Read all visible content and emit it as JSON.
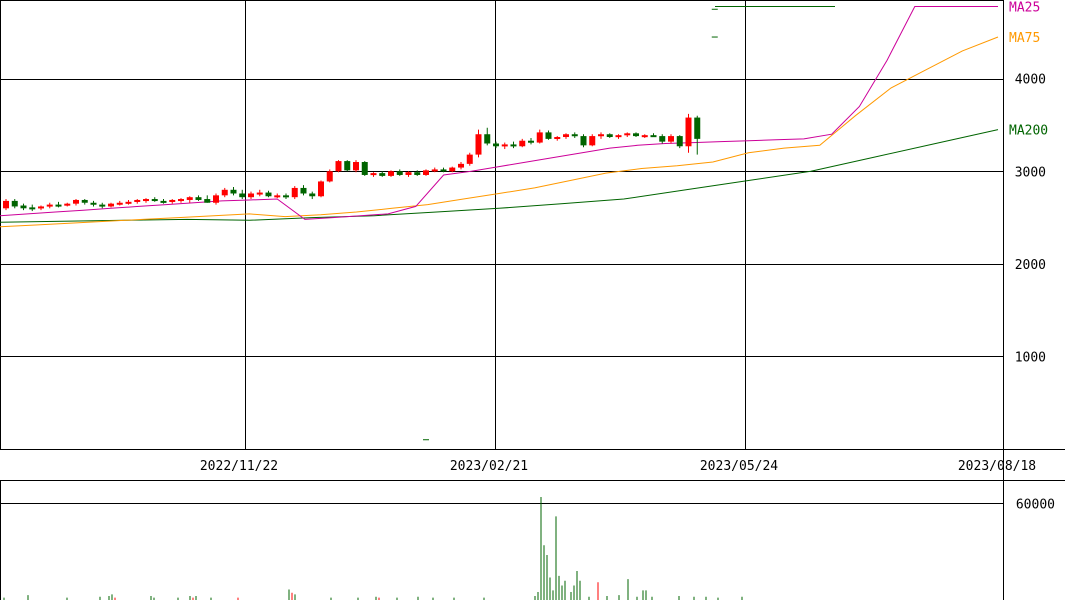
{
  "chart_data": [
    {
      "type": "candlestick",
      "title": "",
      "x_tick_labels": [
        "2022/11/22",
        "2023/02/21",
        "2023/05/24",
        "2023/08/18"
      ],
      "y_ticks": [
        1000,
        2000,
        3000,
        4000
      ],
      "ylim": [
        0,
        4850
      ],
      "grid": true,
      "colors": {
        "up": "#ff0000",
        "down": "#006400",
        "ma25": "#cc0099",
        "ma75": "#ff9900",
        "ma200": "#006400"
      },
      "legend": [
        {
          "name": "MA25",
          "color": "#cc0099",
          "value": 4780
        },
        {
          "name": "MA75",
          "color": "#ff9900",
          "value": 4450
        },
        {
          "name": "MA200",
          "color": "#006400",
          "value": 3450
        }
      ],
      "candles": [
        {
          "o": 2600,
          "h": 2700,
          "l": 2580,
          "c": 2680
        },
        {
          "o": 2680,
          "h": 2700,
          "l": 2600,
          "c": 2620
        },
        {
          "o": 2630,
          "h": 2650,
          "l": 2580,
          "c": 2600
        },
        {
          "o": 2610,
          "h": 2640,
          "l": 2570,
          "c": 2590
        },
        {
          "o": 2600,
          "h": 2630,
          "l": 2580,
          "c": 2620
        },
        {
          "o": 2620,
          "h": 2660,
          "l": 2600,
          "c": 2640
        },
        {
          "o": 2640,
          "h": 2670,
          "l": 2610,
          "c": 2620
        },
        {
          "o": 2630,
          "h": 2660,
          "l": 2620,
          "c": 2650
        },
        {
          "o": 2650,
          "h": 2700,
          "l": 2630,
          "c": 2690
        },
        {
          "o": 2690,
          "h": 2700,
          "l": 2640,
          "c": 2660
        },
        {
          "o": 2660,
          "h": 2680,
          "l": 2620,
          "c": 2640
        },
        {
          "o": 2640,
          "h": 2660,
          "l": 2600,
          "c": 2620
        },
        {
          "o": 2620,
          "h": 2660,
          "l": 2610,
          "c": 2650
        },
        {
          "o": 2650,
          "h": 2680,
          "l": 2630,
          "c": 2660
        },
        {
          "o": 2660,
          "h": 2690,
          "l": 2640,
          "c": 2670
        },
        {
          "o": 2670,
          "h": 2700,
          "l": 2650,
          "c": 2690
        },
        {
          "o": 2690,
          "h": 2710,
          "l": 2660,
          "c": 2700
        },
        {
          "o": 2700,
          "h": 2720,
          "l": 2670,
          "c": 2680
        },
        {
          "o": 2680,
          "h": 2700,
          "l": 2650,
          "c": 2670
        },
        {
          "o": 2670,
          "h": 2700,
          "l": 2650,
          "c": 2690
        },
        {
          "o": 2690,
          "h": 2710,
          "l": 2660,
          "c": 2700
        },
        {
          "o": 2690,
          "h": 2730,
          "l": 2660,
          "c": 2720
        },
        {
          "o": 2720,
          "h": 2740,
          "l": 2680,
          "c": 2690
        },
        {
          "o": 2700,
          "h": 2740,
          "l": 2660,
          "c": 2660
        },
        {
          "o": 2660,
          "h": 2760,
          "l": 2640,
          "c": 2740
        },
        {
          "o": 2740,
          "h": 2820,
          "l": 2720,
          "c": 2800
        },
        {
          "o": 2800,
          "h": 2830,
          "l": 2740,
          "c": 2760
        },
        {
          "o": 2760,
          "h": 2800,
          "l": 2700,
          "c": 2720
        },
        {
          "o": 2720,
          "h": 2780,
          "l": 2700,
          "c": 2760
        },
        {
          "o": 2760,
          "h": 2800,
          "l": 2730,
          "c": 2770
        },
        {
          "o": 2770,
          "h": 2790,
          "l": 2720,
          "c": 2730
        },
        {
          "o": 2730,
          "h": 2760,
          "l": 2710,
          "c": 2740
        },
        {
          "o": 2740,
          "h": 2760,
          "l": 2700,
          "c": 2720
        },
        {
          "o": 2720,
          "h": 2840,
          "l": 2700,
          "c": 2820
        },
        {
          "o": 2820,
          "h": 2850,
          "l": 2740,
          "c": 2760
        },
        {
          "o": 2760,
          "h": 2780,
          "l": 2700,
          "c": 2730
        },
        {
          "o": 2730,
          "h": 2900,
          "l": 2720,
          "c": 2890
        },
        {
          "o": 2890,
          "h": 3020,
          "l": 2880,
          "c": 3000
        },
        {
          "o": 3000,
          "h": 3120,
          "l": 2990,
          "c": 3110
        },
        {
          "o": 3110,
          "h": 3120,
          "l": 3000,
          "c": 3010
        },
        {
          "o": 3010,
          "h": 3120,
          "l": 2990,
          "c": 3100
        },
        {
          "o": 3100,
          "h": 3110,
          "l": 2950,
          "c": 2960
        },
        {
          "o": 2960,
          "h": 2990,
          "l": 2940,
          "c": 2980
        },
        {
          "o": 2980,
          "h": 3000,
          "l": 2940,
          "c": 2950
        },
        {
          "o": 2950,
          "h": 3010,
          "l": 2940,
          "c": 3000
        },
        {
          "o": 3000,
          "h": 3020,
          "l": 2950,
          "c": 2960
        },
        {
          "o": 2960,
          "h": 3000,
          "l": 2940,
          "c": 2990
        },
        {
          "o": 2990,
          "h": 3010,
          "l": 2950,
          "c": 2960
        },
        {
          "o": 2960,
          "h": 3020,
          "l": 2950,
          "c": 3010
        },
        {
          "o": 3010,
          "h": 3040,
          "l": 2990,
          "c": 3020
        },
        {
          "o": 3020,
          "h": 3040,
          "l": 2990,
          "c": 3000
        },
        {
          "o": 3000,
          "h": 3050,
          "l": 2990,
          "c": 3040
        },
        {
          "o": 3040,
          "h": 3100,
          "l": 3020,
          "c": 3080
        },
        {
          "o": 3080,
          "h": 3200,
          "l": 3060,
          "c": 3180
        },
        {
          "o": 3180,
          "h": 3450,
          "l": 3150,
          "c": 3400
        },
        {
          "o": 3400,
          "h": 3470,
          "l": 3280,
          "c": 3300
        },
        {
          "o": 3300,
          "h": 3320,
          "l": 3250,
          "c": 3270
        },
        {
          "o": 3270,
          "h": 3310,
          "l": 3240,
          "c": 3290
        },
        {
          "o": 3290,
          "h": 3320,
          "l": 3250,
          "c": 3270
        },
        {
          "o": 3270,
          "h": 3350,
          "l": 3260,
          "c": 3330
        },
        {
          "o": 3330,
          "h": 3360,
          "l": 3290,
          "c": 3310
        },
        {
          "o": 3310,
          "h": 3450,
          "l": 3300,
          "c": 3420
        },
        {
          "o": 3420,
          "h": 3440,
          "l": 3340,
          "c": 3350
        },
        {
          "o": 3350,
          "h": 3380,
          "l": 3330,
          "c": 3370
        },
        {
          "o": 3370,
          "h": 3410,
          "l": 3350,
          "c": 3400
        },
        {
          "o": 3400,
          "h": 3420,
          "l": 3360,
          "c": 3380
        },
        {
          "o": 3380,
          "h": 3400,
          "l": 3260,
          "c": 3280
        },
        {
          "o": 3280,
          "h": 3400,
          "l": 3270,
          "c": 3380
        },
        {
          "o": 3380,
          "h": 3420,
          "l": 3350,
          "c": 3400
        },
        {
          "o": 3400,
          "h": 3410,
          "l": 3360,
          "c": 3370
        },
        {
          "o": 3370,
          "h": 3400,
          "l": 3350,
          "c": 3390
        },
        {
          "o": 3390,
          "h": 3420,
          "l": 3370,
          "c": 3410
        },
        {
          "o": 3410,
          "h": 3420,
          "l": 3370,
          "c": 3380
        },
        {
          "o": 3380,
          "h": 3400,
          "l": 3360,
          "c": 3390
        },
        {
          "o": 3390,
          "h": 3410,
          "l": 3370,
          "c": 3380
        },
        {
          "o": 3380,
          "h": 3400,
          "l": 3300,
          "c": 3320
        },
        {
          "o": 3320,
          "h": 3400,
          "l": 3300,
          "c": 3380
        },
        {
          "o": 3380,
          "h": 3390,
          "l": 3250,
          "c": 3270
        },
        {
          "o": 3270,
          "h": 3620,
          "l": 3200,
          "c": 3580
        },
        {
          "o": 3580,
          "h": 3600,
          "l": 3180,
          "c": 3350
        }
      ],
      "stray_marks": [
        {
          "x_index": 81,
          "value": 4450
        },
        {
          "x_index": 81,
          "value": 4750
        },
        {
          "x_index": 48,
          "value": 100
        }
      ],
      "ma25": [
        2520,
        2540,
        2560,
        2580,
        2600,
        2620,
        2640,
        2660,
        2680,
        2690,
        2700,
        2480,
        2500,
        2520,
        2540,
        2620,
        2960,
        3000,
        3050,
        3100,
        3150,
        3200,
        3250,
        3280,
        3300,
        3310,
        3320,
        3330,
        3340,
        3350,
        3400,
        3700,
        4200,
        4780,
        4780,
        4780,
        4780
      ],
      "ma75": [
        2400,
        2420,
        2440,
        2460,
        2480,
        2500,
        2520,
        2540,
        2510,
        2530,
        2560,
        2600,
        2640,
        2700,
        2760,
        2820,
        2900,
        2980,
        3030,
        3060,
        3100,
        3200,
        3250,
        3280,
        3600,
        3900,
        4100,
        4300,
        4450
      ],
      "ma200": [
        2450,
        2460,
        2470,
        2480,
        2470,
        2500,
        2520,
        2560,
        2600,
        2650,
        2700,
        2800,
        2900,
        3000,
        3150,
        3300,
        3450
      ],
      "volume": {
        "y_ticks": [
          60000
        ],
        "ylim": [
          0,
          64000
        ],
        "bars": [
          {
            "i": 0,
            "v": 1500,
            "up": false
          },
          {
            "i": 8,
            "v": 3000,
            "up": false
          },
          {
            "i": 21,
            "v": 1500,
            "up": false
          },
          {
            "i": 32,
            "v": 2000,
            "up": false
          },
          {
            "i": 35,
            "v": 2500,
            "up": false
          },
          {
            "i": 36,
            "v": 3500,
            "up": false
          },
          {
            "i": 37,
            "v": 1500,
            "up": true
          },
          {
            "i": 49,
            "v": 2500,
            "up": false
          },
          {
            "i": 50,
            "v": 1500,
            "up": false
          },
          {
            "i": 58,
            "v": 1500,
            "up": false
          },
          {
            "i": 62,
            "v": 2500,
            "up": false
          },
          {
            "i": 63,
            "v": 1500,
            "up": true
          },
          {
            "i": 64,
            "v": 2500,
            "up": false
          },
          {
            "i": 69,
            "v": 1500,
            "up": false
          },
          {
            "i": 78,
            "v": 1500,
            "up": true
          },
          {
            "i": 95,
            "v": 6500,
            "up": false
          },
          {
            "i": 96,
            "v": 4500,
            "up": true
          },
          {
            "i": 97,
            "v": 3500,
            "up": false
          },
          {
            "i": 109,
            "v": 1500,
            "up": false
          },
          {
            "i": 118,
            "v": 1500,
            "up": false
          },
          {
            "i": 124,
            "v": 2000,
            "up": false
          },
          {
            "i": 125,
            "v": 1500,
            "up": true
          },
          {
            "i": 131,
            "v": 1500,
            "up": false
          },
          {
            "i": 138,
            "v": 2000,
            "up": false
          },
          {
            "i": 143,
            "v": 1500,
            "up": false
          },
          {
            "i": 150,
            "v": 1500,
            "up": false
          },
          {
            "i": 160,
            "v": 1500,
            "up": false
          },
          {
            "i": 177,
            "v": 2500,
            "up": false
          },
          {
            "i": 178,
            "v": 5000,
            "up": false
          },
          {
            "i": 179,
            "v": 64000,
            "up": false
          },
          {
            "i": 180,
            "v": 34000,
            "up": false
          },
          {
            "i": 181,
            "v": 28000,
            "up": false
          },
          {
            "i": 182,
            "v": 14000,
            "up": false
          },
          {
            "i": 183,
            "v": 6000,
            "up": false
          },
          {
            "i": 184,
            "v": 52000,
            "up": false
          },
          {
            "i": 185,
            "v": 15000,
            "up": false
          },
          {
            "i": 186,
            "v": 9000,
            "up": false
          },
          {
            "i": 187,
            "v": 12000,
            "up": false
          },
          {
            "i": 189,
            "v": 5000,
            "up": false
          },
          {
            "i": 190,
            "v": 9000,
            "up": false
          },
          {
            "i": 191,
            "v": 18000,
            "up": false
          },
          {
            "i": 192,
            "v": 12000,
            "up": false
          },
          {
            "i": 195,
            "v": 2000,
            "up": false
          },
          {
            "i": 198,
            "v": 11000,
            "up": true
          },
          {
            "i": 201,
            "v": 2500,
            "up": false
          },
          {
            "i": 205,
            "v": 3000,
            "up": false
          },
          {
            "i": 208,
            "v": 13000,
            "up": false
          },
          {
            "i": 211,
            "v": 2000,
            "up": false
          },
          {
            "i": 213,
            "v": 6000,
            "up": false
          },
          {
            "i": 214,
            "v": 6000,
            "up": false
          },
          {
            "i": 216,
            "v": 2000,
            "up": false
          },
          {
            "i": 225,
            "v": 2500,
            "up": false
          },
          {
            "i": 230,
            "v": 2000,
            "up": false
          },
          {
            "i": 234,
            "v": 2000,
            "up": false
          },
          {
            "i": 238,
            "v": 1500,
            "up": false
          },
          {
            "i": 246,
            "v": 2000,
            "up": false
          }
        ]
      }
    }
  ]
}
